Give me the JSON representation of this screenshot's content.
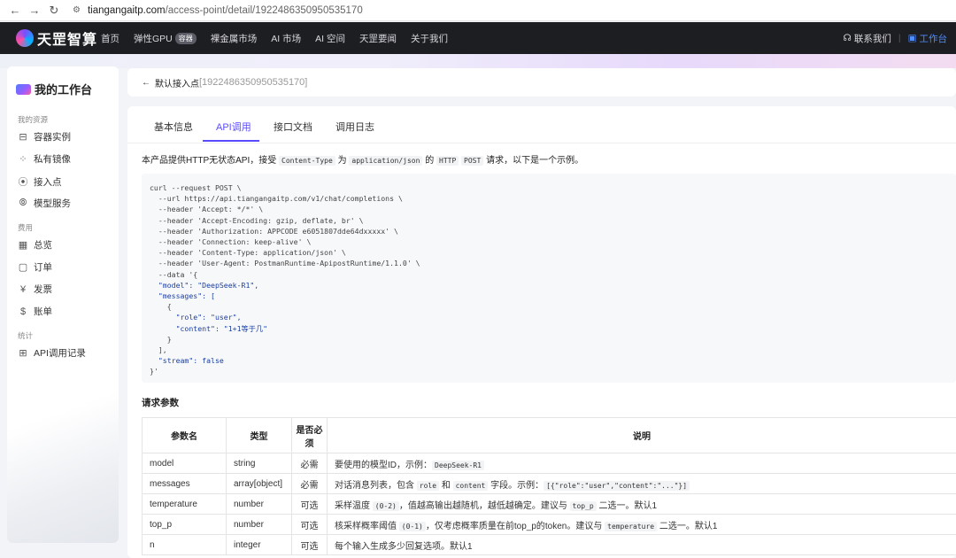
{
  "browser": {
    "url_host": "tiangangaitp.com",
    "url_path": "/access-point/detail/1922486350950535170"
  },
  "topnav": {
    "logo_text": "天罡智算",
    "items": [
      "首页",
      "弹性GPU",
      "裸金属市场",
      "AI 市场",
      "AI 空间",
      "天罡要闻",
      "关于我们"
    ],
    "gpu_badge": "容器",
    "contact": "联系我们",
    "workbench": "工作台"
  },
  "sidebar": {
    "title": "我的工作台",
    "sections": {
      "resources": "我的资源",
      "billing": "费用",
      "stats": "统计"
    },
    "items": {
      "containers": "容器实例",
      "images": "私有镜像",
      "access": "接入点",
      "models": "模型服务",
      "overview": "总览",
      "orders": "订单",
      "invoices": "发票",
      "bills": "账单",
      "api_logs": "API调用记录"
    }
  },
  "breadcrumb": {
    "name": "默认接入点",
    "id": "[1922486350950535170]"
  },
  "tabs": {
    "basic": "基本信息",
    "api": "API调用",
    "docs": "接口文档",
    "logs": "调用日志"
  },
  "intro": {
    "p1": "本产品提供HTTP无状态API，接受 ",
    "c1": "Content-Type",
    "p2": " 为 ",
    "c2": "application/json",
    "p3": " 的 ",
    "c3": "HTTP",
    "p4": " ",
    "c4": "POST",
    "p5": " 请求，以下是一个示例。"
  },
  "code": {
    "l01": "curl --request POST \\",
    "l02": "  --url https://api.tiangangaitp.com/v1/chat/completions \\",
    "l03": "  --header 'Accept: */*' \\",
    "l04": "  --header 'Accept-Encoding: gzip, deflate, br' \\",
    "l05": "  --header 'Authorization: APPCODE e6051807dde64dxxxxx' \\",
    "l06": "  --header 'Connection: keep-alive' \\",
    "l07": "  --header 'Content-Type: application/json' \\",
    "l08": "  --header 'User-Agent: PostmanRuntime-ApipostRuntime/1.1.0' \\",
    "l09": "  --data '{",
    "l10": "  \"model\": \"DeepSeek-R1\",",
    "l11": "  \"messages\": [",
    "l12": "    {",
    "l13": "      \"role\": \"user\",",
    "l14": "      \"content\": \"1+1等于几\"",
    "l15": "    }",
    "l16": "  ],",
    "l17": "  \"stream\": false",
    "l18": "}'"
  },
  "params": {
    "title": "请求参数",
    "headers": {
      "name": "参数名",
      "type": "类型",
      "required": "是否必须",
      "desc": "说明"
    },
    "rows": [
      {
        "name": "model",
        "type": "string",
        "required": "必需",
        "d1": "要使用的模型ID，示例：",
        "dc": "DeepSeek-R1",
        "d2": ""
      },
      {
        "name": "messages",
        "type": "array[object]",
        "required": "必需",
        "d1": "对话消息列表，包含 ",
        "dc": "role",
        "d2": " 和 ",
        "dc2": "content",
        "d3": " 字段。示例：",
        "dc3": "[{\"role\":\"user\",\"content\":\"...\"}]"
      },
      {
        "name": "temperature",
        "type": "number",
        "required": "可选",
        "d1": "采样温度 ",
        "dc": "(0-2)",
        "d2": "，值越高输出越随机，越低越确定。建议与 ",
        "dc2": "top_p",
        "d3": " 二选一。默认1"
      },
      {
        "name": "top_p",
        "type": "number",
        "required": "可选",
        "d1": "核采样概率阈值 ",
        "dc": "(0-1)",
        "d2": "，仅考虑概率质量在前top_p的token。建议与 ",
        "dc2": "temperature",
        "d3": " 二选一。默认1"
      },
      {
        "name": "n",
        "type": "integer",
        "required": "可选",
        "d1": "每个输入生成多少回复选项。默认1"
      }
    ]
  }
}
